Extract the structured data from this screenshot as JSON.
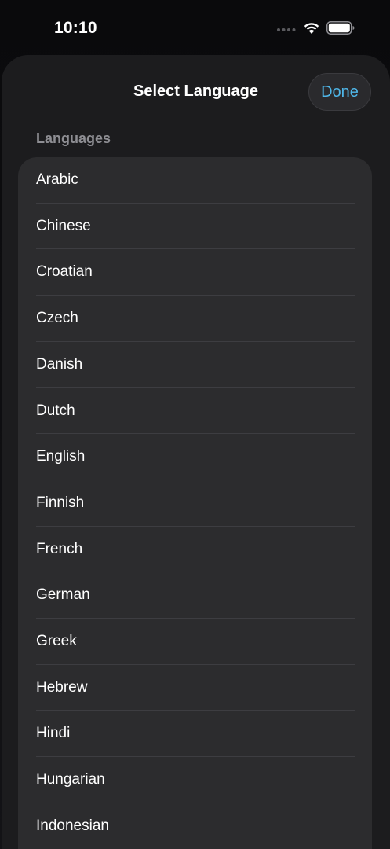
{
  "status_bar": {
    "time": "10:10"
  },
  "sheet": {
    "title": "Select Language",
    "done_label": "Done",
    "accent_color": "#4fb6e8"
  },
  "section": {
    "header": "Languages"
  },
  "languages": [
    "Arabic",
    "Chinese",
    "Croatian",
    "Czech",
    "Danish",
    "Dutch",
    "English",
    "Finnish",
    "French",
    "German",
    "Greek",
    "Hebrew",
    "Hindi",
    "Hungarian",
    "Indonesian"
  ]
}
